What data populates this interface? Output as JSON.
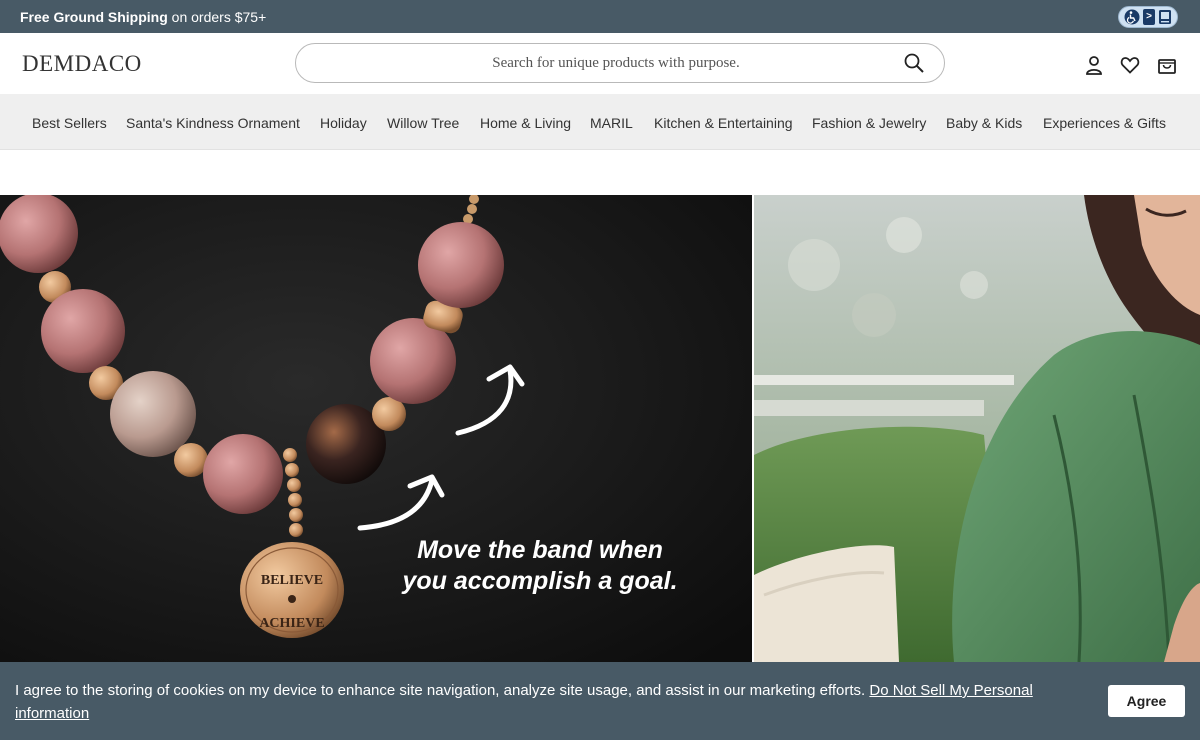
{
  "topbar": {
    "promo_bold": "Free Ground Shipping",
    "promo_rest": " on orders $75+"
  },
  "header": {
    "logo": "DEMDACO",
    "search_placeholder": "Search for unique products with purpose."
  },
  "nav": {
    "items": [
      "Best Sellers",
      "Santa's Kindness Ornament",
      "Holiday",
      "Willow Tree",
      "Home & Living",
      "MARIL",
      "Kitchen & Entertaining",
      "Fashion & Jewelry",
      "Baby & Kids",
      "Experiences & Gifts"
    ]
  },
  "hero": {
    "caption_line1": "Move the band when",
    "caption_line2": "you accomplish a goal.",
    "charm_line1": "BELIEVE",
    "charm_line2": "ACHIEVE"
  },
  "cookie": {
    "text": "I agree to the storing of cookies on my device to enhance site navigation, analyze site usage, and assist in our marketing efforts. ",
    "link": "Do Not Sell My Personal information",
    "agree_label": "Agree"
  },
  "colors": {
    "banner_bg": "#485a66",
    "nav_bg": "#efefef"
  },
  "icons": [
    "accessibility-icon",
    "search-icon",
    "account-icon",
    "heart-icon",
    "bag-icon"
  ]
}
